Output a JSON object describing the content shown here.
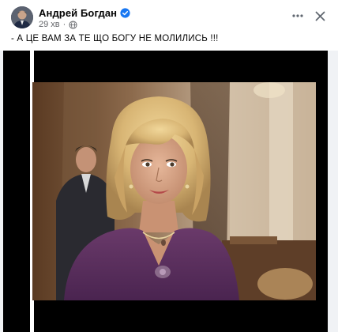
{
  "post": {
    "author_name": "Андрей Богдан",
    "timestamp": "29 хв",
    "text": "- А ЦЕ ВАМ ЗА ТЕ ЩО БОГУ НЕ МОЛИЛИСЬ !!!"
  },
  "icons": {
    "verified": "verified-badge-icon",
    "privacy": "globe-icon",
    "more": "more-horizontal-icon",
    "close": "close-icon"
  },
  "colors": {
    "verified_blue": "#1877f2",
    "text_primary": "#050505",
    "text_secondary": "#65676b",
    "media_background": "#000000"
  }
}
